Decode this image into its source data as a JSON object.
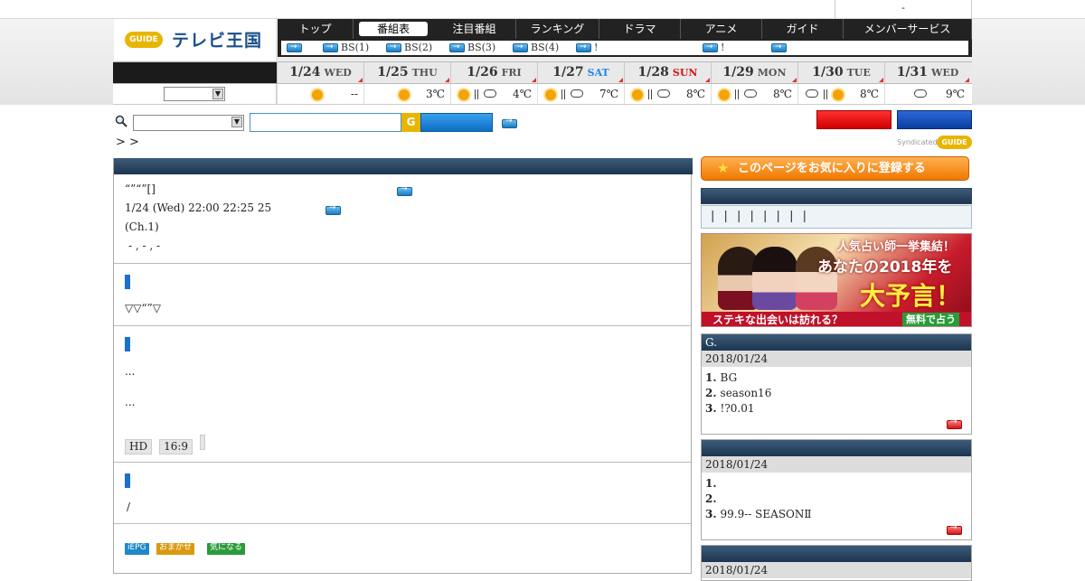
{
  "top_strip": {
    "text": "-"
  },
  "logo": {
    "mark": "GUIDE",
    "name": "テレビ王国"
  },
  "nav": {
    "items": [
      "トップ",
      "番組表",
      "注目番組",
      "ランキング",
      "ドラマ",
      "アニメ",
      "ガイド",
      "メンバーサービス"
    ],
    "active": "番組表"
  },
  "subnav": {
    "items": [
      "",
      "BS(1)",
      "BS(2)",
      "BS(3)",
      "BS(4)",
      "!",
      "!",
      ""
    ]
  },
  "dates": [
    {
      "date": "1/24",
      "dow": "WED"
    },
    {
      "date": "1/25",
      "dow": "THU"
    },
    {
      "date": "1/26",
      "dow": "FRI"
    },
    {
      "date": "1/27",
      "dow": "SAT"
    },
    {
      "date": "1/28",
      "dow": "SUN"
    },
    {
      "date": "1/29",
      "dow": "MON"
    },
    {
      "date": "1/30",
      "dow": "TUE"
    },
    {
      "date": "1/31",
      "dow": "WED"
    }
  ],
  "weather": [
    {
      "icons": [
        "sun"
      ],
      "temp": "--"
    },
    {
      "icons": [
        "sun"
      ],
      "temp": "3℃"
    },
    {
      "icons": [
        "sun",
        "sep",
        "cloud"
      ],
      "temp": "4℃"
    },
    {
      "icons": [
        "sun",
        "sep",
        "cloud"
      ],
      "temp": "7℃"
    },
    {
      "icons": [
        "sun",
        "sep",
        "cloud"
      ],
      "temp": "8℃"
    },
    {
      "icons": [
        "sun",
        "sep",
        "cloud"
      ],
      "temp": "8℃"
    },
    {
      "icons": [
        "cloud",
        "sep",
        "sun"
      ],
      "temp": "8℃"
    },
    {
      "icons": [
        "cloud"
      ],
      "temp": "9℃"
    }
  ],
  "breadcrumb": "> >",
  "syndicated": {
    "label": "Syndicated",
    "mark": "GUIDE"
  },
  "program": {
    "title": "“”“”[]",
    "datetime": "1/24 (Wed) 22:00  22:25 25",
    "channel": "(Ch.1)",
    "cast": "-     , -     , -",
    "section2_text": "▽▽“”▽",
    "section3_line1": "...",
    "section3_line2": "...",
    "tags": [
      "HD",
      "16:9",
      ""
    ],
    "section4_text": "/",
    "badges": [
      {
        "label": "iEPG",
        "color": "#1e88c8"
      },
      {
        "label": "おまかせ",
        "color": "#d89a10"
      },
      {
        "label": "気になる",
        "color": "#2a9b3a"
      }
    ]
  },
  "sidebar": {
    "fav_label": "このページをお気に入りに登録する",
    "bars_text": "| | | | | | | |",
    "ad": {
      "line1": "人気占い師一挙集結！",
      "line2": "あなたの2018年を",
      "line3": "大予言！",
      "line4": "ステキな出会いは訪れる？",
      "line5": "無料で占う"
    },
    "rank1": {
      "header": "G.",
      "date": "2018/01/24",
      "items": [
        "BG",
        "season16",
        "!?0.01"
      ]
    },
    "rank2": {
      "header": "",
      "date": "2018/01/24",
      "items": [
        "",
        "",
        "99.9-- SEASONⅡ"
      ]
    },
    "rank3": {
      "date": "2018/01/24"
    }
  }
}
